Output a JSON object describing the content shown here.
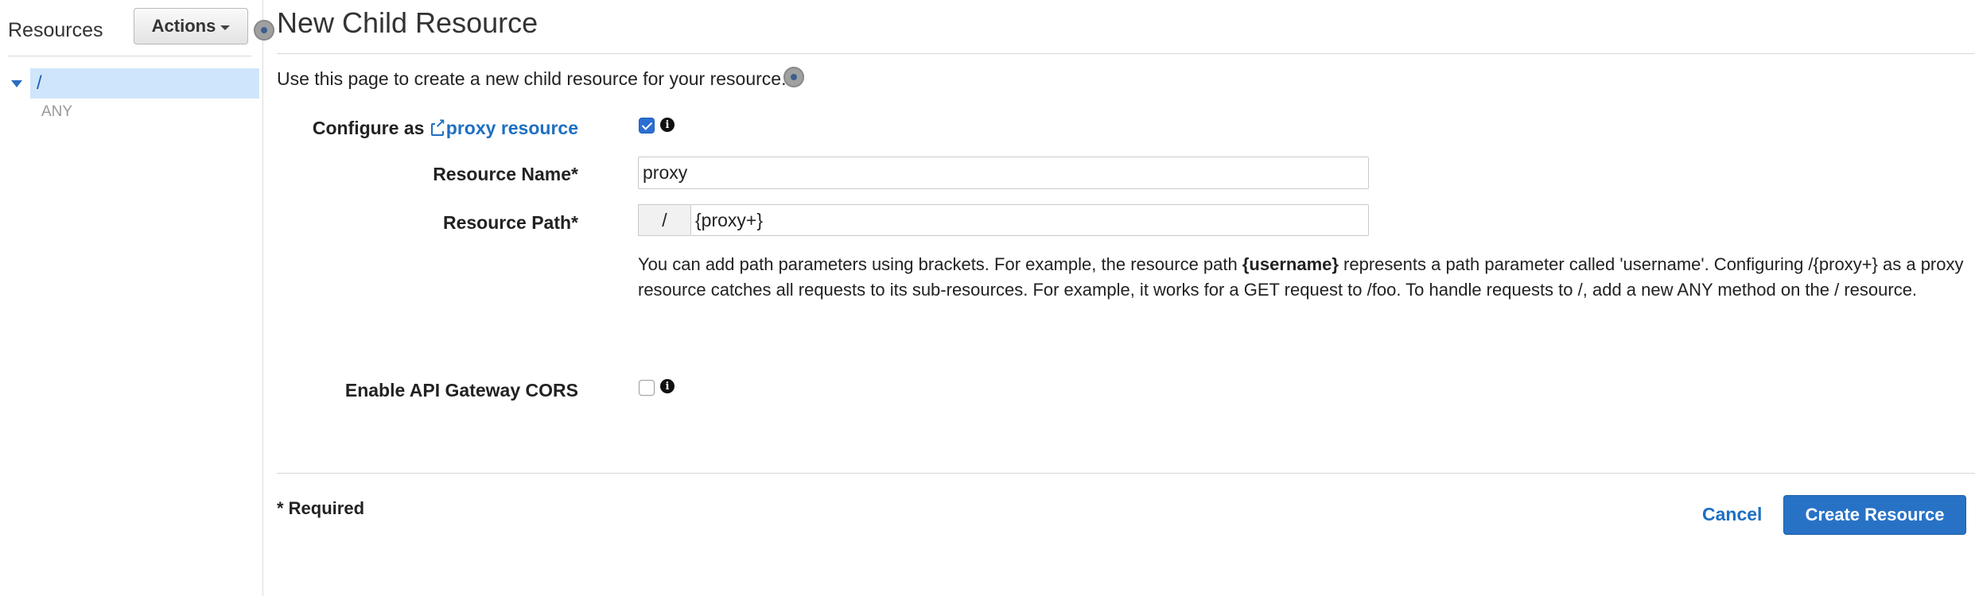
{
  "sidebar": {
    "title": "Resources",
    "actions_label": "Actions",
    "tree": {
      "root_label": "/",
      "children": [
        "ANY"
      ]
    }
  },
  "main": {
    "title": "New Child Resource",
    "description": "Use this page to create a new child resource for your resource.",
    "form": {
      "proxy": {
        "label_prefix": "Configure as",
        "link_text": "proxy resource",
        "checked": true
      },
      "resource_name": {
        "label": "Resource Name*",
        "value": "proxy"
      },
      "resource_path": {
        "label": "Resource Path*",
        "prefix": "/",
        "value": "{proxy+}"
      },
      "help": {
        "part1": "You can add path parameters using brackets. For example, the resource path ",
        "bold": "{username}",
        "part2": " represents a path parameter called 'username'. Configuring /{proxy+} as a proxy resource catches all requests to its sub-resources. For example, it works for a GET request to /foo. To handle requests to /, add a new ANY method on the / resource."
      },
      "cors": {
        "label": "Enable API Gateway CORS",
        "checked": false
      }
    },
    "required_note": "* Required",
    "buttons": {
      "cancel": "Cancel",
      "create": "Create Resource"
    }
  },
  "icons": {
    "caret": "caret-down-icon",
    "tree_toggle": "triangle-down-icon",
    "info": "info-icon",
    "external_link": "external-link-icon",
    "dot": "dot-icon"
  },
  "colors": {
    "link": "#1f6fc2",
    "primary_button": "#2872c6",
    "selected_row": "#cfe5fb"
  }
}
